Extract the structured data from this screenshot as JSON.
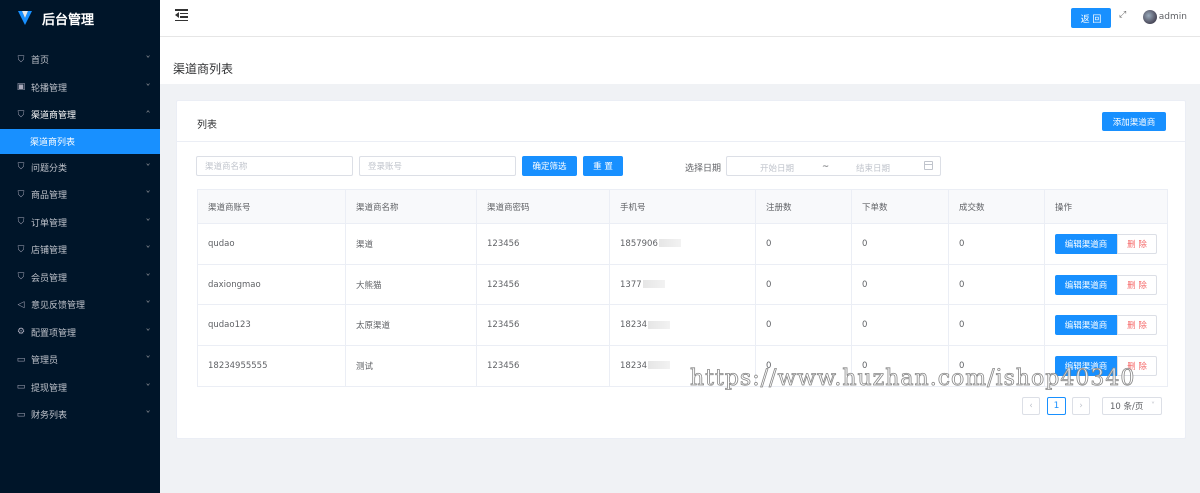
{
  "app": {
    "title": "后台管理"
  },
  "sidebar": {
    "items": [
      {
        "label": "首页",
        "icon": "person-icon",
        "arrow": "˅"
      },
      {
        "label": "轮播管理",
        "icon": "image-icon",
        "arrow": "˅"
      },
      {
        "label": "渠道商管理",
        "icon": "person-icon",
        "arrow": "˄",
        "open": true
      },
      {
        "label": "问题分类",
        "icon": "person-icon",
        "arrow": "˅"
      },
      {
        "label": "商品管理",
        "icon": "person-icon",
        "arrow": "˅"
      },
      {
        "label": "订单管理",
        "icon": "person-icon",
        "arrow": "˅"
      },
      {
        "label": "店铺管理",
        "icon": "person-icon",
        "arrow": "˅"
      },
      {
        "label": "会员管理",
        "icon": "person-icon",
        "arrow": "˅"
      },
      {
        "label": "意见反馈管理",
        "icon": "megaphone-icon",
        "arrow": "˅"
      },
      {
        "label": "配置项管理",
        "icon": "gear-icon",
        "arrow": "˅"
      },
      {
        "label": "管理员",
        "icon": "folder-icon",
        "arrow": "˅"
      },
      {
        "label": "提现管理",
        "icon": "folder-icon",
        "arrow": "˅"
      },
      {
        "label": "财务列表",
        "icon": "folder-icon",
        "arrow": "˅"
      }
    ],
    "sub_active": "渠道商列表"
  },
  "header": {
    "back_label": "返 回",
    "username": "admin"
  },
  "page": {
    "title": "渠道商列表"
  },
  "card": {
    "title": "列表",
    "add_label": "添加渠道商"
  },
  "filters": {
    "name_placeholder": "渠道商名称",
    "account_placeholder": "登录账号",
    "confirm_label": "确定筛选",
    "reset_label": "重 置",
    "date_label": "选择日期",
    "start_placeholder": "开始日期",
    "range_separator": "~",
    "end_placeholder": "结束日期"
  },
  "table": {
    "headers": [
      "渠道商账号",
      "渠道商名称",
      "渠道商密码",
      "手机号",
      "注册数",
      "下单数",
      "成交数",
      "操作"
    ],
    "rows": [
      {
        "account": "qudao",
        "name": "渠道",
        "password": "123456",
        "phone": "1857906",
        "registered": "0",
        "orders": "0",
        "deals": "0"
      },
      {
        "account": "daxiongmao",
        "name": "大熊猫",
        "password": "123456",
        "phone": "1377",
        "registered": "0",
        "orders": "0",
        "deals": "0"
      },
      {
        "account": "qudao123",
        "name": "太原渠道",
        "password": "123456",
        "phone": "18234",
        "registered": "0",
        "orders": "0",
        "deals": "0"
      },
      {
        "account": "18234955555",
        "name": "测试",
        "password": "123456",
        "phone": "18234",
        "registered": "0",
        "orders": "0",
        "deals": "0"
      }
    ],
    "edit_label": "编辑渠道商",
    "delete_label": "删 除"
  },
  "pagination": {
    "prev": "‹",
    "current": "1",
    "next": "›",
    "page_size": "10 条/页"
  },
  "watermark": "https://www.huzhan.com/ishop40340",
  "colors": {
    "primary": "#1890ff",
    "sidebar_bg": "#001529",
    "danger": "#f56c6c"
  }
}
